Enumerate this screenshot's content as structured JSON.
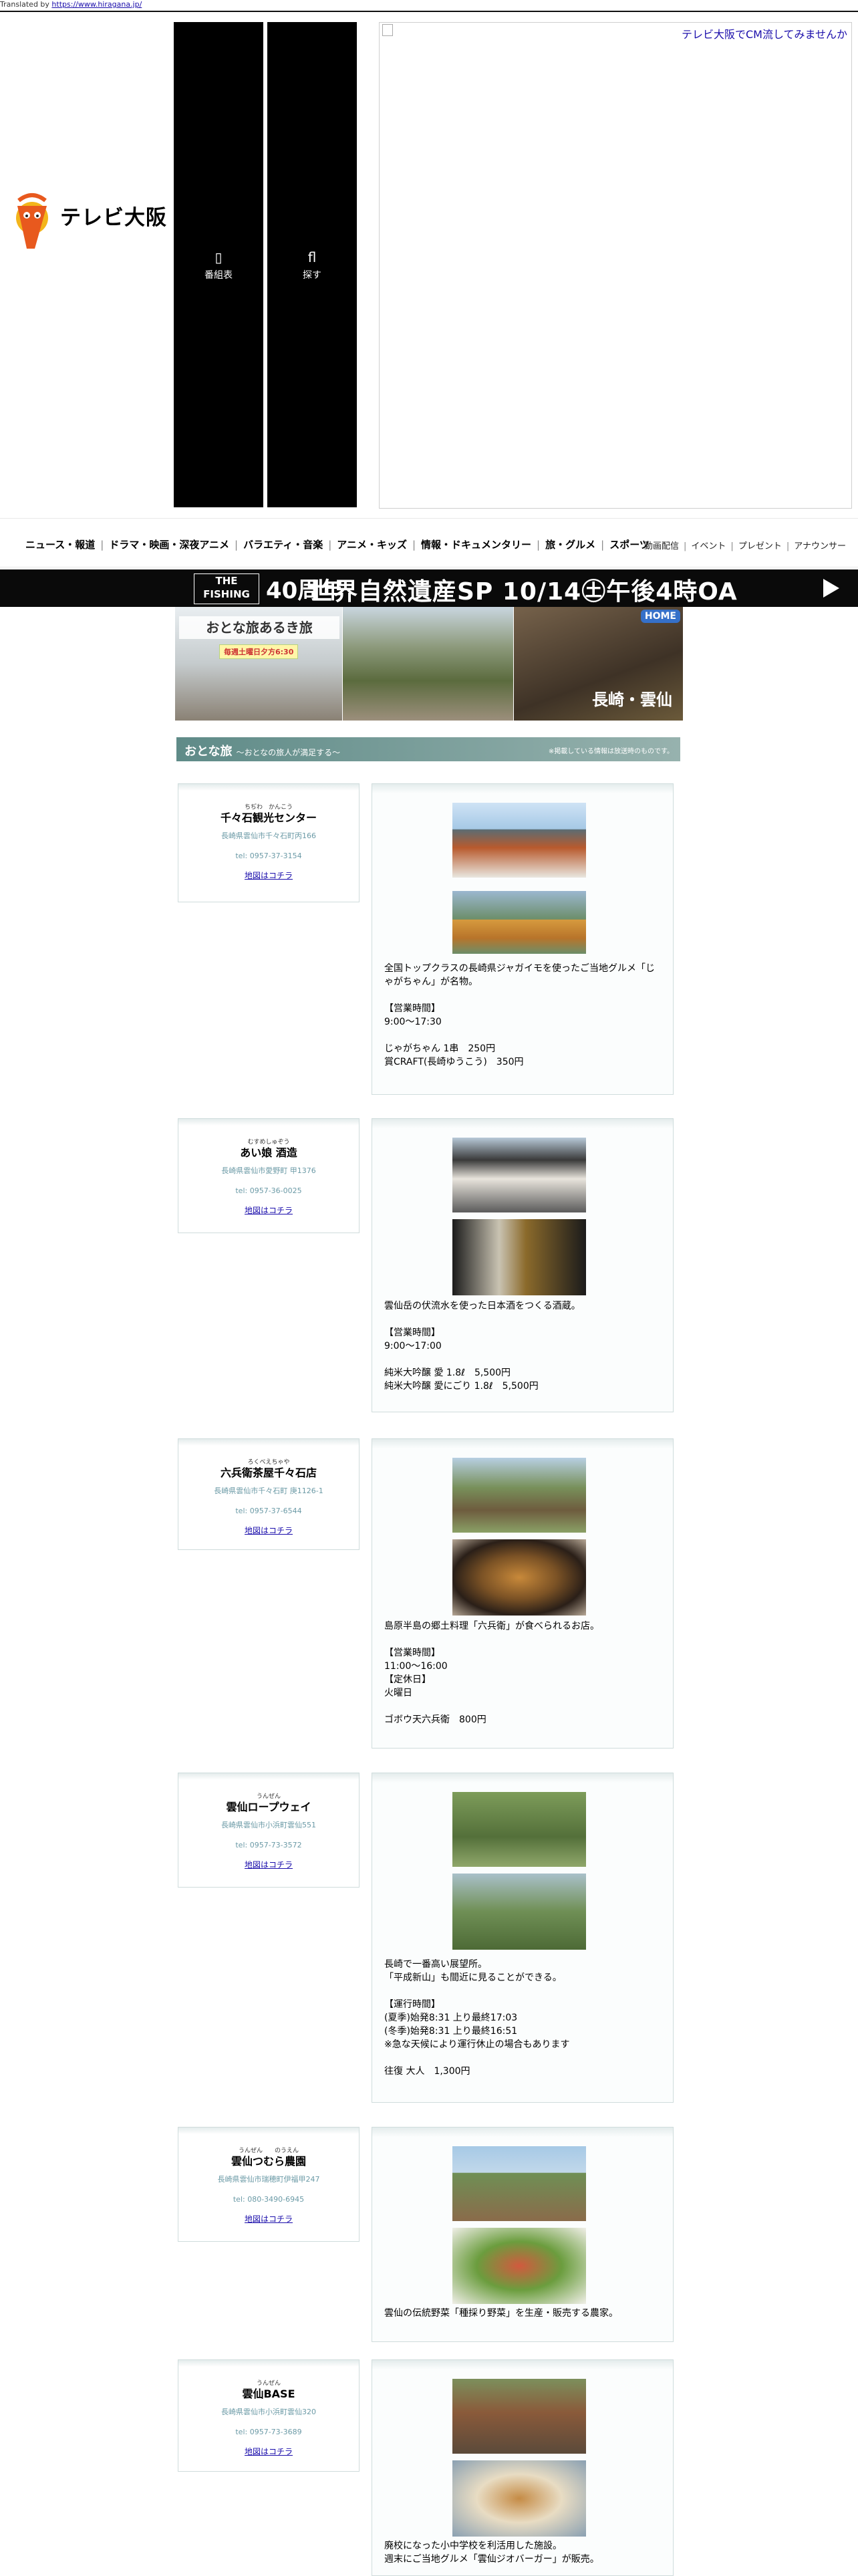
{
  "header": {
    "translated_by_prefix": "Translated by ",
    "translated_by_link": "https://www.hiragana.jp/",
    "logo_text": "テレビ大阪",
    "nav_buttons": [
      {
        "icon": "tv-schedule-icon",
        "glyph": "▯",
        "label": "番組表"
      },
      {
        "icon": "search-icon",
        "glyph": "fl",
        "label": "探す"
      }
    ],
    "ad_link": "テレビ大阪でCM流してみませんか"
  },
  "global_nav": {
    "main": [
      "ニュース・報道",
      "ドラマ・映画・深夜アニメ",
      "バラエティ・音楽",
      "アニメ・キッズ",
      "情報・ドキュメンタリー",
      "旅・グルメ",
      "スポーツ"
    ],
    "sub": [
      "動画配信",
      "イベント",
      "プレゼント",
      "アナウンサー"
    ]
  },
  "banner": {
    "the_fishing": "THE\nFISHING",
    "anniversary": "40周年",
    "title": "世界自然遺産SP 10/14㊏午後4時OA"
  },
  "hero": {
    "show_title": "おとな旅あるき旅",
    "schedule": "毎週土曜日夕方6:30",
    "home": "HOME",
    "place": "長崎・雲仙"
  },
  "section": {
    "title": "おとな旅",
    "subtitle": "～おとなの旅人が満足する～",
    "note": "※掲載している情報は放送時のものです。"
  },
  "spots": [
    {
      "ruby": "ちぢわ　かんこう",
      "name": "千々石観光センター",
      "address": "長崎県雲仙市千々石町丙166",
      "tel": "tel: 0957-37-3154",
      "map": "地図はコチラ",
      "photos": [
        "ph-shop",
        "ph-dango"
      ],
      "description": "全国トップクラスの長崎県ジャガイモを使ったご当地グルメ「じゃがちゃん」が名物。\n\n【営業時間】\n9:00～17:30\n\nじゃがちゃん 1串　250円\n賞CRAFT(長崎ゆうこう)　350円"
    },
    {
      "ruby": "むすめしゅぞう",
      "name": "あい娘 酒造",
      "address": "長崎県雲仙市愛野町 甲1376",
      "tel": "tel: 0957-36-0025",
      "map": "地図はコチラ",
      "photos": [
        "ph-brew",
        "ph-sake"
      ],
      "description": "雲仙岳の伏流水を使った日本酒をつくる酒蔵。\n\n【営業時間】\n9:00～17:00\n\n純米大吟醸 愛 1.8ℓ　5,500円\n純米大吟醸 愛にごり 1.8ℓ　5,500円"
    },
    {
      "ruby": "ろくべえちゃや",
      "name": "六兵衛茶屋千々石店",
      "address": "長崎県雲仙市千々石町 庚1126-1",
      "tel": "tel: 0957-37-6544",
      "map": "地図はコチラ",
      "photos": [
        "ph-house",
        "ph-bowl"
      ],
      "description": "島原半島の郷土料理「六兵衛」が食べられるお店。\n\n【営業時間】\n11:00～16:00\n【定休日】\n火曜日\n\nゴボウ天六兵衛　800円"
    },
    {
      "ruby": "うんぜん",
      "name": "雲仙ロープウェイ",
      "address": "長崎県雲仙市小浜町雲仙551",
      "tel": "tel: 0957-73-3572",
      "map": "地図はコチラ",
      "photos": [
        "ph-rope1",
        "ph-rope2"
      ],
      "description": "長崎で一番高い展望所。\n「平成新山」も間近に見ることができる。\n\n【運行時間】\n(夏季)始発8:31 上り最終17:03\n(冬季)始発8:31 上り最終16:51\n※急な天候により運行休止の場合もあります\n\n往復 大人　1,300円"
    },
    {
      "ruby": "うんぜん　　のうえん",
      "name": "雲仙つむら農園",
      "address": "長崎県雲仙市瑞穂町伊福甲247",
      "tel": "tel: 080-3490-6945",
      "map": "地図はコチラ",
      "photos": [
        "ph-farm",
        "ph-veg"
      ],
      "description": "雲仙の伝統野菜「種採り野菜」を生産・販売する農家。"
    },
    {
      "ruby": "うんぜん",
      "name": "雲仙BASE",
      "address": "長崎県雲仙市小浜町雲仙320",
      "tel": "tel: 0957-73-3689",
      "map": "地図はコチラ",
      "photos": [
        "ph-base",
        "ph-burger"
      ],
      "description": "廃校になった小中学校を利活用した施設。\n週末にご当地グルメ「雲仙ジオバーガー」が販売。"
    }
  ]
}
